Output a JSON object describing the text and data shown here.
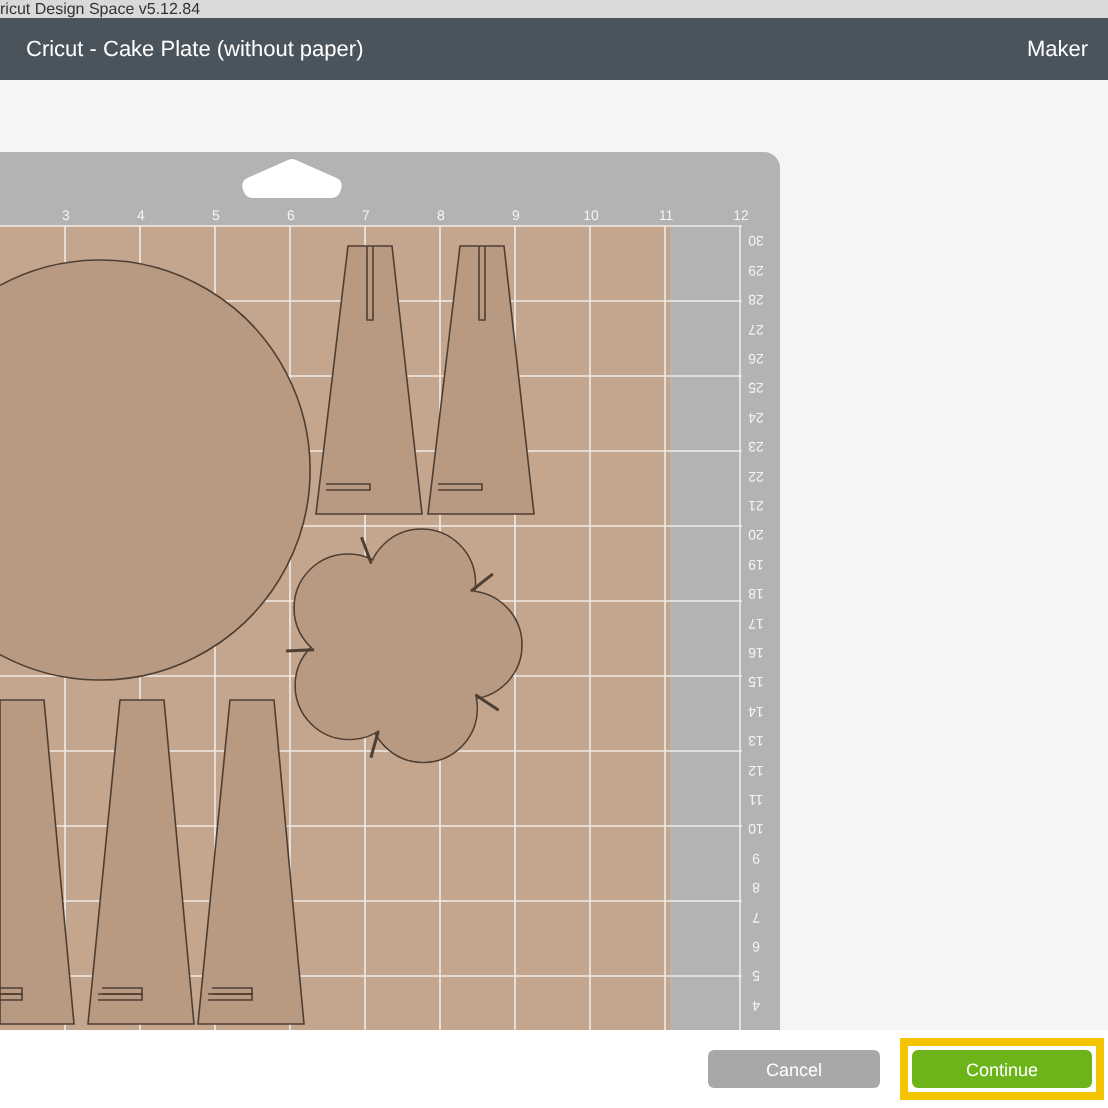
{
  "window": {
    "title": "ricut Design Space  v5.12.84"
  },
  "header": {
    "title": "Cricut - Cake Plate (without paper)",
    "machine": "Maker"
  },
  "mat": {
    "top_ruler": [
      "3",
      "4",
      "5",
      "6",
      "7",
      "8",
      "9",
      "10",
      "11",
      "12"
    ],
    "side_ruler": [
      "30",
      "29",
      "28",
      "27",
      "26",
      "25",
      "24",
      "23",
      "22",
      "21",
      "20",
      "19",
      "18",
      "17",
      "16",
      "15",
      "14",
      "13",
      "12",
      "11",
      "10",
      "9",
      "8",
      "7",
      "6",
      "5",
      "4"
    ]
  },
  "buttons": [
    {
      "label": "Cancel",
      "kind": "secondary",
      "highlighted": false
    },
    {
      "label": "Continue",
      "kind": "primary",
      "highlighted": true
    }
  ]
}
